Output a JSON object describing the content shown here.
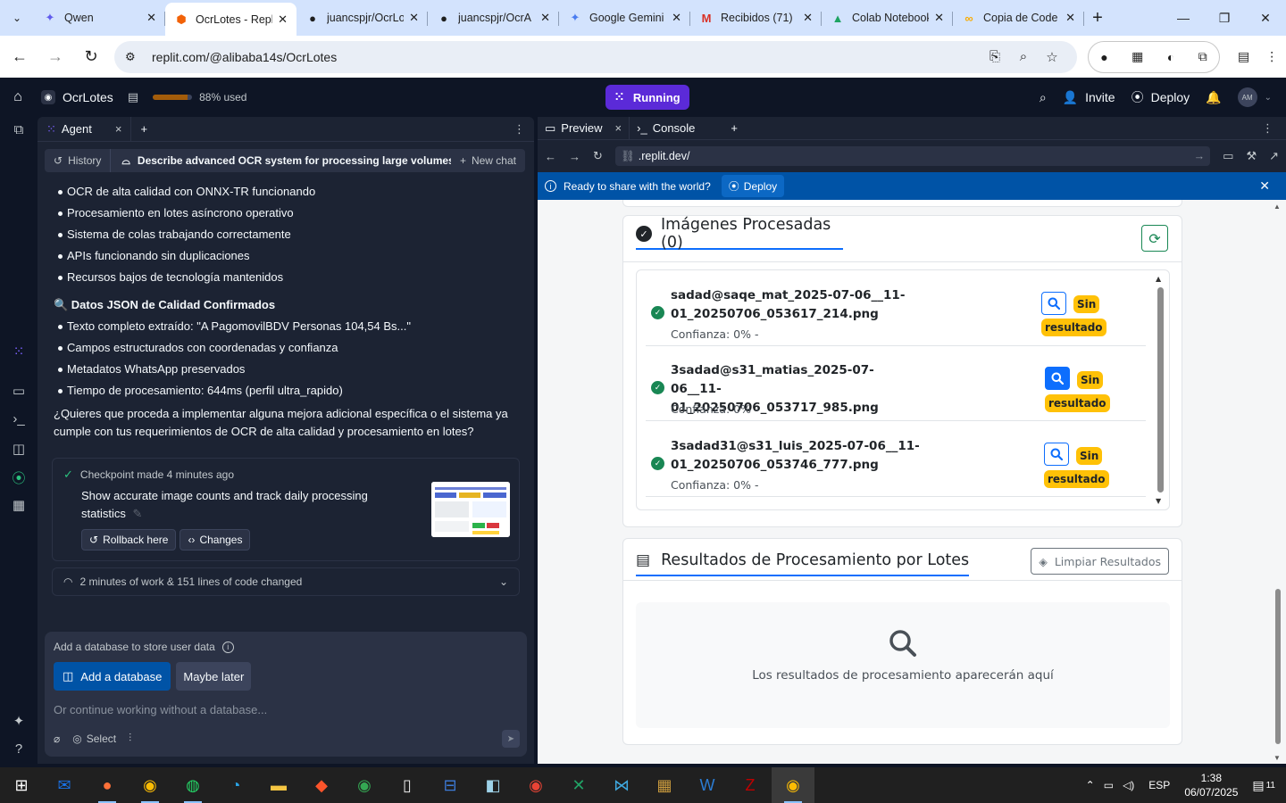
{
  "browser": {
    "tabs": [
      {
        "title": "Qwen",
        "icon": "qwen-icon",
        "glyph": "✦",
        "color": "#615ced"
      },
      {
        "title": "OcrLotes - Replit",
        "icon": "replit-icon",
        "glyph": "⬢",
        "color": "#f26207"
      },
      {
        "title": "juancspjr/OcrLotes",
        "icon": "github-icon",
        "glyph": "●",
        "color": "#1f1f1f"
      },
      {
        "title": "juancspjr/OcrA",
        "icon": "github-icon",
        "glyph": "●",
        "color": "#1f1f1f"
      },
      {
        "title": "Google Gemini",
        "icon": "gemini-icon",
        "glyph": "✦",
        "color": "#4a7cf0"
      },
      {
        "title": "Recibidos (71)",
        "icon": "gmail-icon",
        "glyph": "M",
        "color": "#d93025"
      },
      {
        "title": "Colab Notebook",
        "icon": "drive-icon",
        "glyph": "▲",
        "color": "#1ea362"
      },
      {
        "title": "Copia de Code",
        "icon": "colab-icon",
        "glyph": "∞",
        "color": "#f9ab00"
      }
    ],
    "url": "replit.com/@alibaba14s/OcrLotes"
  },
  "replit": {
    "project_name": "OcrLotes",
    "usage_text": "88% used",
    "usage_fraction": 0.88,
    "run_label": "Running",
    "invite_label": "Invite",
    "deploy_label": "Deploy",
    "avatar_initials": "AM"
  },
  "agent": {
    "tab_label": "Agent",
    "history_label": "History",
    "chat_title": "Describe advanced OCR system for processing large volumes of do...",
    "new_chat_label": "New chat",
    "bullets_1": [
      "OCR de alta calidad con ONNX-TR funcionando",
      "Procesamiento en lotes asíncrono operativo",
      "Sistema de colas trabajando correctamente",
      "APIs funcionando sin duplicaciones",
      "Recursos bajos de tecnología mantenidos"
    ],
    "section_header": "🔍 Datos JSON de Calidad Confirmados",
    "bullets_2": [
      "Texto completo extraído: \"A PagomovilBDV Personas 104,54 Bs...\"",
      "Campos estructurados con coordenadas y confianza",
      "Metadatos WhatsApp preservados",
      "Tiempo de procesamiento: 644ms (perfil ultra_rapido)"
    ],
    "question": "¿Quieres que proceda a implementar alguna mejora adicional específica o el sistema ya cumple con tus requerimientos de OCR de alta calidad y procesamiento en lotes?",
    "checkpoint": {
      "meta": "Checkpoint made 4 minutes ago",
      "description": "Show accurate image counts and track daily processing statistics",
      "rollback_label": "Rollback here",
      "changes_label": "Changes"
    },
    "work_summary": "2 minutes of work & 151 lines of code changed",
    "composer": {
      "db_hint": "Add a database to store user data",
      "add_db_label": "Add a database",
      "maybe_later_label": "Maybe later",
      "placeholder": "Or continue working without a database...",
      "select_label": "Select"
    }
  },
  "preview": {
    "tab_preview": "Preview",
    "tab_console": "Console",
    "url": ".replit.dev/",
    "share_text": "Ready to share with the world?",
    "share_deploy": "Deploy"
  },
  "app": {
    "processed_title": "Imágenes Procesadas (0)",
    "images": [
      {
        "name": "sadad@saqe_mat_2025-07-06__11-01_20250706_053617_214.png",
        "confidence": "Confianza: 0% -",
        "status": "Sin resultado"
      },
      {
        "name": "3sadad@s31_matias_2025-07-06__11-01_20250706_053717_985.png",
        "confidence": "Confianza: 0% -",
        "status": "Sin resultado"
      },
      {
        "name": "3sadad31@s31_luis_2025-07-06__11-01_20250706_053746_777.png",
        "confidence": "Confianza: 0% -",
        "status": "Sin resultado"
      }
    ],
    "results_title": "Resultados de Procesamiento por Lotes",
    "clear_label": "Limpiar Resultados",
    "empty_text": "Los resultados de procesamiento aparecerán aquí"
  },
  "taskbar": {
    "lang": "ESP",
    "time": "1:38",
    "date": "06/07/2025",
    "notif_count": "11"
  }
}
